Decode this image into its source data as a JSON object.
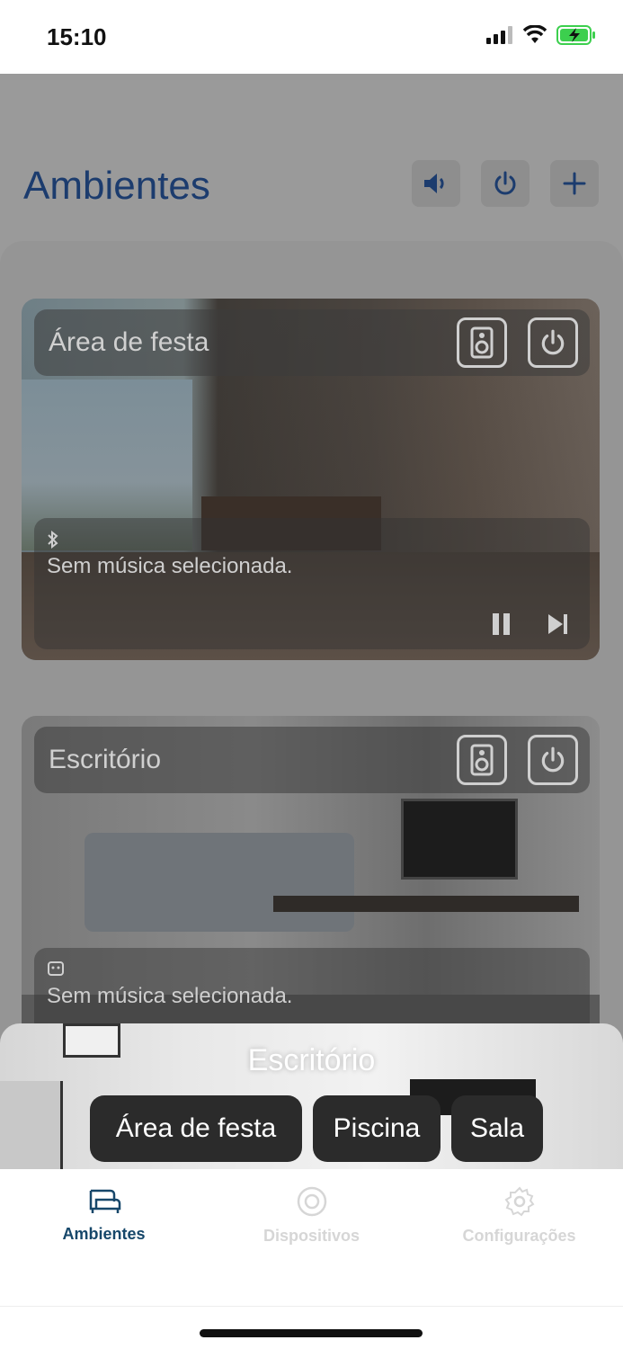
{
  "status_bar": {
    "time": "15:10",
    "battery_color": "#3ccf4e"
  },
  "header": {
    "title": "Ambientes",
    "buttons": [
      {
        "name": "volume",
        "icon": "speaker-volume-icon"
      },
      {
        "name": "power",
        "icon": "power-icon"
      },
      {
        "name": "add",
        "icon": "plus-icon"
      }
    ]
  },
  "rooms": [
    {
      "name": "Área de festa",
      "source_icon": "bluetooth-icon",
      "music": "Sem música selecionada."
    },
    {
      "name": "Escritório",
      "source_icon": "source-icon",
      "music": "Sem música selecionada."
    }
  ],
  "room_switcher": {
    "current": "Escritório",
    "options": [
      "Área de festa",
      "Piscina",
      "Sala"
    ]
  },
  "tab_bar": {
    "items": [
      {
        "label": "Ambientes",
        "icon": "sofa-icon",
        "active": true
      },
      {
        "label": "Dispositivos",
        "icon": "speaker-circle-icon",
        "active": false
      },
      {
        "label": "Configurações",
        "icon": "gear-icon",
        "active": false
      }
    ],
    "active_color": "#16476a"
  }
}
